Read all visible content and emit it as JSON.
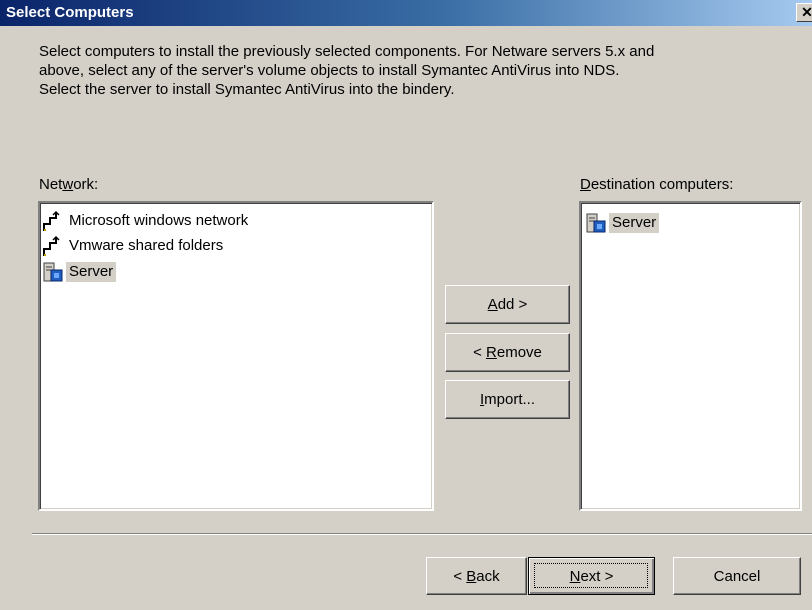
{
  "dialog": {
    "title": "Select Computers",
    "close_glyph": "✕"
  },
  "description": {
    "line1": "Select computers to install the previously selected components.  For Netware servers 5.x and",
    "line2": "above, select any of the server's volume objects to install Symantec AntiVirus into NDS.",
    "line3": "Select the server to install Symantec AntiVirus into the bindery."
  },
  "network": {
    "label_pre": "Net",
    "label_key": "w",
    "label_post": "ork:",
    "items": [
      {
        "label": "Microsoft windows network",
        "icon": "network-icon"
      },
      {
        "label": "Vmware shared folders",
        "icon": "network-icon"
      },
      {
        "label": "Server",
        "icon": "server-icon",
        "selected": true
      }
    ]
  },
  "destination": {
    "label_key": "D",
    "label_post": "estination computers:",
    "items": [
      {
        "label": "Server",
        "icon": "server-icon",
        "selected": true
      }
    ]
  },
  "buttons": {
    "add": {
      "key": "A",
      "post": "dd >"
    },
    "remove": {
      "pre": "< ",
      "key": "R",
      "post": "emove"
    },
    "import": {
      "key": "I",
      "post": "mport..."
    },
    "back": {
      "pre": "< ",
      "key": "B",
      "post": "ack"
    },
    "next": {
      "key": "N",
      "post": "ext >"
    },
    "cancel": "Cancel"
  },
  "colors": {
    "dialog_bg": "#d4d0c8",
    "title_start": "#0a246a",
    "title_end": "#a6caf0"
  }
}
